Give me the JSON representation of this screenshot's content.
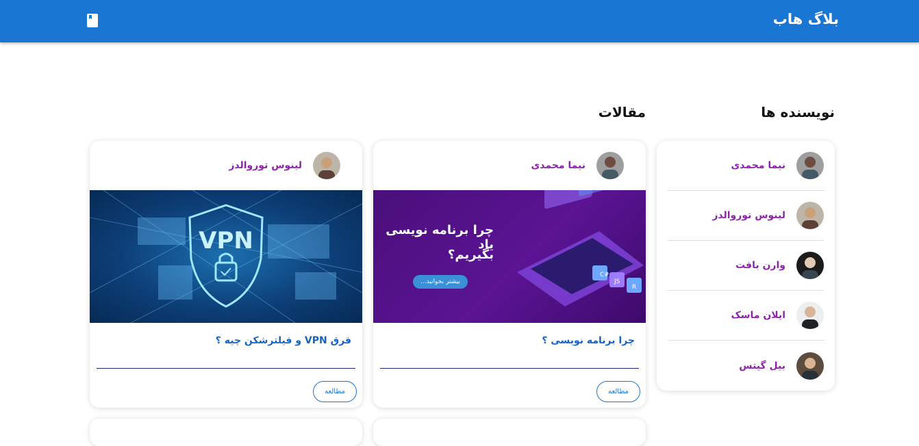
{
  "app": {
    "brand": "بلاگ هاب",
    "book_icon": "book-icon"
  },
  "sections": {
    "authors_title": "نویسنده ها",
    "articles_title": "مقالات"
  },
  "authors": [
    {
      "name": "نیما محمدی"
    },
    {
      "name": "لینوس توروالدز"
    },
    {
      "name": "وارن بافت"
    },
    {
      "name": "ایلان ماسک"
    },
    {
      "name": "بیل گیتس"
    }
  ],
  "articles": [
    {
      "author": "نیما محمدی",
      "title": "چرا برنامه نویسی ؟",
      "read_label": "مطالعه",
      "image_text": {
        "line1": "چرا برنامه نویسی یاد",
        "line2": "بگیریم؟",
        "button": "بیشتر بخوانید..."
      }
    },
    {
      "author": "لینوس توروالدز",
      "title": "فرق VPN و فیلترشکن چیه ؟",
      "read_label": "مطالعه",
      "image_text": {
        "badge": "VPN"
      }
    }
  ],
  "colors": {
    "appbar": "#1976d2",
    "author_name": "#8e24aa",
    "article_title": "#1565c0"
  }
}
